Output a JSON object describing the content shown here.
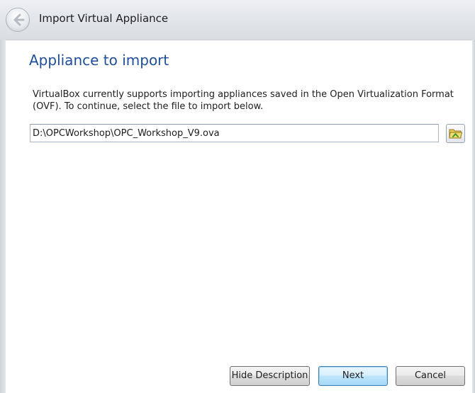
{
  "window": {
    "title": "Import Virtual Appliance"
  },
  "page": {
    "title": "Appliance to import",
    "description": "VirtualBox currently supports importing appliances saved in the Open Virtualization Format (OVF). To continue, select the file to import below."
  },
  "file_picker": {
    "value": "D:\\OPCWorkshop\\OPC_Workshop_V9.ova",
    "browse_icon": "open-folder-icon"
  },
  "buttons": {
    "hide_description": "Hide Description",
    "next": "Next",
    "cancel": "Cancel"
  },
  "icons": {
    "back": "back-arrow-icon"
  },
  "colors": {
    "title_accent": "#1f4e9a",
    "default_button_border": "#3c7fb1"
  }
}
